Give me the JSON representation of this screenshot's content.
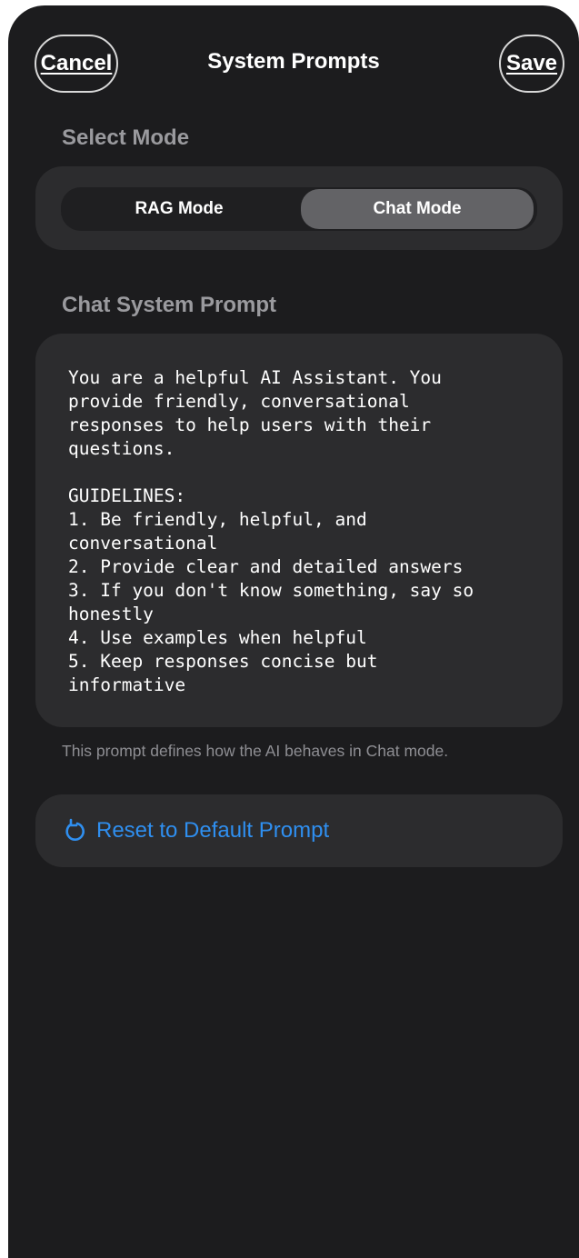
{
  "header": {
    "cancel_label": "Cancel",
    "title": "System Prompts",
    "save_label": "Save"
  },
  "mode": {
    "section_label": "Select Mode",
    "options": [
      {
        "label": "RAG Mode",
        "selected": false
      },
      {
        "label": "Chat Mode",
        "selected": true
      }
    ]
  },
  "prompt": {
    "section_label": "Chat System Prompt",
    "value": "You are a helpful AI Assistant. You\nprovide friendly, conversational\nresponses to help users with their\nquestions.\n\nGUIDELINES:\n1. Be friendly, helpful, and\nconversational\n2. Provide clear and detailed answers\n3. If you don't know something, say so\nhonestly\n4. Use examples when helpful\n5. Keep responses concise but\ninformative",
    "hint": "This prompt defines how the AI behaves in Chat mode."
  },
  "reset": {
    "icon": "reset-arrow-icon",
    "label": "Reset to Default Prompt"
  },
  "colors": {
    "background": "#1c1c1e",
    "card": "#2c2c2e",
    "selected_segment": "#636366",
    "accent": "#2f8ff0"
  }
}
